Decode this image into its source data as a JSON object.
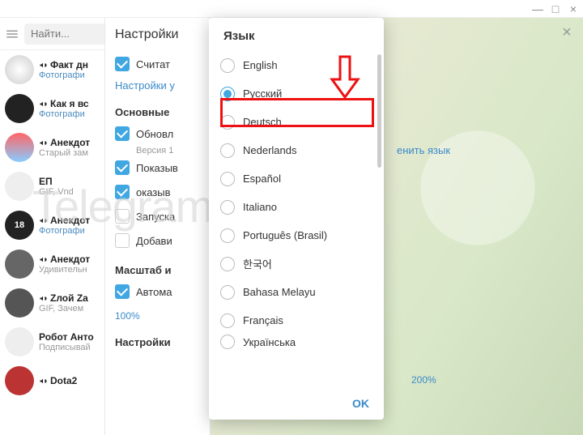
{
  "window": {
    "minimize": "—",
    "maximize": "□",
    "close": "×"
  },
  "search": {
    "placeholder": "Найти..."
  },
  "chats": [
    {
      "name": "Факт дн",
      "sub": "Фотографи",
      "subClass": "",
      "av": "av-1",
      "icon": true
    },
    {
      "name": "Как я вс",
      "sub": "Фотографи",
      "subClass": "",
      "av": "av-2",
      "icon": true
    },
    {
      "name": "Анекдот",
      "sub": "Старый зам",
      "subClass": "gray",
      "av": "av-3",
      "icon": true
    },
    {
      "name": "ЕП",
      "sub": "GIF, Vnd",
      "subClass": "gray",
      "av": "av-4",
      "icon": false
    },
    {
      "name": "Анекдот",
      "sub": "Фотографи",
      "subClass": "",
      "av": "av-5",
      "icon": true,
      "avText": "18"
    },
    {
      "name": "Анекдот",
      "sub": "Удивительн",
      "subClass": "gray",
      "av": "av-6",
      "icon": true
    },
    {
      "name": "Zлой Za",
      "sub": "GIF, Зачем",
      "subClass": "gray",
      "av": "av-7",
      "icon": true
    },
    {
      "name": "Робот Анто",
      "sub": "Подписывай",
      "subClass": "gray",
      "av": "av-4",
      "icon": false
    },
    {
      "name": "Dota2",
      "sub": "",
      "subClass": "",
      "av": "av-8",
      "icon": true
    }
  ],
  "settings": {
    "title": "Настройки",
    "count_media": "Считат",
    "notif_link": "Настройки у",
    "section_main": "Основные",
    "update": "Обновл",
    "version": "Версия 1",
    "show1": "Показыв",
    "show2": "оказыв",
    "launch": "Запуска",
    "add": "Добави",
    "section_scale": "Масштаб и",
    "auto": "Автома",
    "pct100": "100%",
    "pct200": "200%",
    "section_notif2": "Настройки"
  },
  "right": {
    "change_lang": "енить язык"
  },
  "lang": {
    "title": "Язык",
    "ok": "OK",
    "items": [
      {
        "label": "English",
        "selected": false
      },
      {
        "label": "Русский",
        "selected": true
      },
      {
        "label": "Deutsch",
        "selected": false
      },
      {
        "label": "Nederlands",
        "selected": false
      },
      {
        "label": "Español",
        "selected": false
      },
      {
        "label": "Italiano",
        "selected": false
      },
      {
        "label": "Português (Brasil)",
        "selected": false
      },
      {
        "label": "한국어",
        "selected": false
      },
      {
        "label": "Bahasa Melayu",
        "selected": false
      },
      {
        "label": "Français",
        "selected": false
      },
      {
        "label": "Українська",
        "selected": false
      }
    ]
  },
  "watermark": "Telegrammix.ru"
}
